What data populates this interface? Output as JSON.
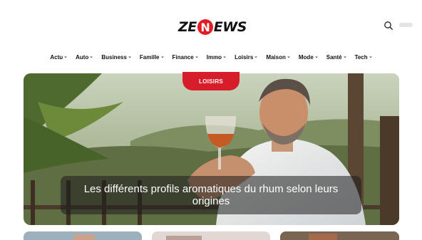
{
  "header": {
    "logo": {
      "prefix": "ZE",
      "highlight": "N",
      "suffix": "EWS"
    },
    "search_icon": "search-icon"
  },
  "nav": {
    "items": [
      {
        "label": "Actu"
      },
      {
        "label": "Auto"
      },
      {
        "label": "Business"
      },
      {
        "label": "Famille"
      },
      {
        "label": "Finance"
      },
      {
        "label": "Immo"
      },
      {
        "label": "Loisirs"
      },
      {
        "label": "Maison"
      },
      {
        "label": "Mode"
      },
      {
        "label": "Santé"
      },
      {
        "label": "Tech"
      }
    ],
    "chevron_icon": "chevron-down-icon"
  },
  "hero": {
    "category": "LOISIRS",
    "title": "Les différents profils aromatiques du rhum selon leurs origines"
  },
  "colors": {
    "accent": "#e31b23",
    "badge": "#d71c2a",
    "text": "#111111"
  }
}
